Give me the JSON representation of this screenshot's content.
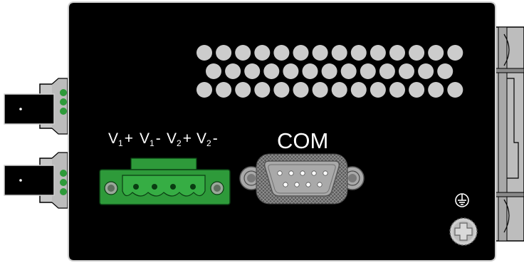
{
  "power_terminal": {
    "v1_plus": {
      "base": "V",
      "sub": "1",
      "sign": "+"
    },
    "v1_minus": {
      "base": "V",
      "sub": "1",
      "sign": "-"
    },
    "v2_plus": {
      "base": "V",
      "sub": "2",
      "sign": "+"
    },
    "v2_minus": {
      "base": "V",
      "sub": "2",
      "sign": "-"
    }
  },
  "com_port": {
    "label": "COM"
  },
  "ground": {
    "icon": "ground-icon"
  },
  "colors": {
    "panel": "#000000",
    "vent_hole": "#cccccc",
    "terminal_block": "#2e9a3a",
    "connector_metal": "#a9a9a9",
    "label": "#ffffff"
  }
}
